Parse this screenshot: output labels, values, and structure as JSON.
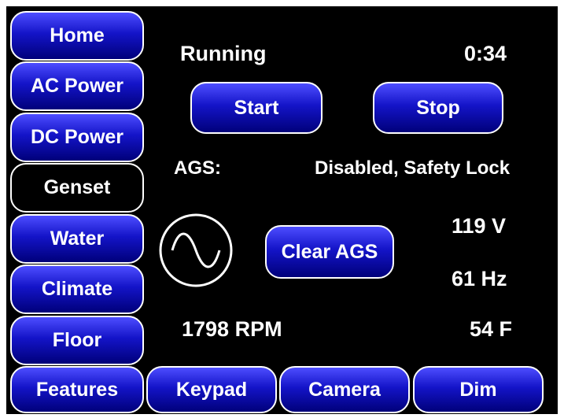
{
  "sidebar": {
    "items": [
      {
        "label": "Home"
      },
      {
        "label": "AC Power"
      },
      {
        "label": "DC Power"
      },
      {
        "label": "Genset",
        "active": true
      },
      {
        "label": "Water"
      },
      {
        "label": "Climate"
      },
      {
        "label": "Floor"
      },
      {
        "label": "Features"
      }
    ]
  },
  "bottom_nav": {
    "keypad": "Keypad",
    "camera": "Camera",
    "dim": "Dim"
  },
  "genset": {
    "status": "Running",
    "runtime": "0:34",
    "start_label": "Start",
    "stop_label": "Stop",
    "ags_label": "AGS:",
    "ags_value": "Disabled, Safety Lock",
    "clear_ags_label": "Clear AGS",
    "voltage": "119 V",
    "frequency": "61 Hz",
    "rpm": "1798 RPM",
    "temperature": "54 F"
  },
  "icons": {
    "ac_wave": "sine-wave-icon"
  },
  "colors": {
    "button_top": "#4d4dff",
    "button_bottom": "#00007a",
    "background": "#000000",
    "text": "#ffffff"
  }
}
